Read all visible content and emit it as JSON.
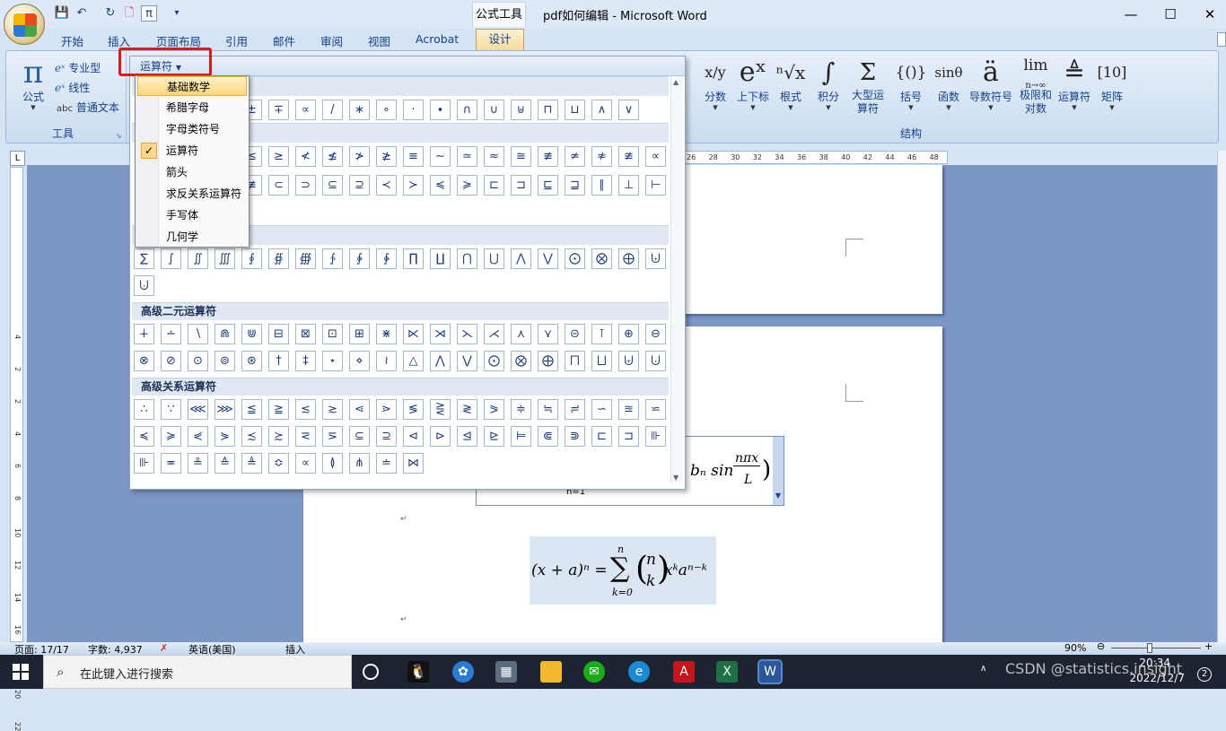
{
  "window": {
    "context_tab": "公式工具",
    "title": "pdf如何编辑 - Microsoft Word",
    "controls": {
      "minimize": "—",
      "maximize": "☐",
      "close": "✕"
    }
  },
  "qat": {
    "save": "💾",
    "undo": "↶",
    "redo": "↻",
    "pdf": "🗋",
    "pi": "π",
    "more": "▾"
  },
  "tabs": [
    "开始",
    "插入",
    "页面布局",
    "引用",
    "邮件",
    "审阅",
    "视图",
    "Acrobat",
    "设计"
  ],
  "ribbon": {
    "tools": {
      "equation_label": "公式",
      "equation_icon": "π",
      "professional": "专业型",
      "linear": "线性",
      "normal_text": "普通文本",
      "normal_text_icon": "abc",
      "group_label": "工具"
    },
    "structures": {
      "group_label": "结构",
      "buttons": [
        {
          "label": "分数",
          "icon": "x/y"
        },
        {
          "label": "上下标",
          "icon": "eˣ"
        },
        {
          "label": "根式",
          "icon": "ⁿ√x"
        },
        {
          "label": "积分",
          "icon": "∫"
        },
        {
          "label": "大型运算符",
          "icon": "Σ"
        },
        {
          "label": "括号",
          "icon": "{()}"
        },
        {
          "label": "函数",
          "icon": "sinθ"
        },
        {
          "label": "导数符号",
          "icon": "ä"
        },
        {
          "label": "极限和对数",
          "icon": "lim"
        },
        {
          "label": "运算符",
          "icon": "≜"
        },
        {
          "label": "矩阵",
          "icon": "[10]"
        }
      ],
      "limit_sub": "n→∞"
    }
  },
  "gallery": {
    "category_button": "运算符",
    "menu": [
      "基础数学",
      "希腊字母",
      "字母类符号",
      "运算符",
      "箭头",
      "求反关系运算符",
      "手写体",
      "几何学"
    ],
    "menu_checked": "运算符",
    "menu_highlighted": "基础数学",
    "row1": [
      "±",
      "∓",
      "∝",
      "/",
      "∗",
      "∘",
      "·",
      "∙",
      "∩",
      "∪",
      "⊎",
      "⊓",
      "⊔",
      "∧",
      "∨"
    ],
    "rel_row1": [
      "≤",
      "≥",
      "≮",
      "≰",
      "≯",
      "≱",
      "≡",
      "∼",
      "≃",
      "≈",
      "≅",
      "≢",
      "≄",
      "≉",
      "≇",
      "∝"
    ],
    "rel_row2": [
      "≢",
      "⊂",
      "⊃",
      "⊆",
      "⊇",
      "≺",
      "≻",
      "≼",
      "≽",
      "⊏",
      "⊐",
      "⊑",
      "⊒",
      "∥",
      "⊥",
      "⊢"
    ],
    "nary_row1": [
      "∑",
      "∫",
      "∬",
      "∭",
      "∮",
      "∯",
      "∰",
      "∱",
      "∲",
      "∳",
      "∏",
      "∐",
      "⋂",
      "⋃",
      "⋀",
      "⋁",
      "⨀",
      "⨂",
      "⨁",
      "⨄"
    ],
    "nary_row2": [
      "⨃"
    ],
    "sec_advanced_binary": "高级二元运算符",
    "adv_bin_row1": [
      "∔",
      "∸",
      "∖",
      "⋒",
      "⋓",
      "⊟",
      "⊠",
      "⊡",
      "⊞",
      "⋇",
      "⋉",
      "⋊",
      "⋋",
      "⋌",
      "⋏",
      "⋎",
      "⊝",
      "⊺",
      "⊕",
      "⊖"
    ],
    "adv_bin_row2": [
      "⊗",
      "⊘",
      "⊙",
      "⊚",
      "⊛",
      "†",
      "‡",
      "⋆",
      "⋄",
      "≀",
      "△",
      "⋀",
      "⋁",
      "⨀",
      "⨂",
      "⨁",
      "⨅",
      "⨆",
      "⨄",
      "⨃"
    ],
    "sec_advanced_relational": "高级关系运算符",
    "adv_rel_row1": [
      "∴",
      "∵",
      "⋘",
      "⋙",
      "≦",
      "≧",
      "≲",
      "≳",
      "⋖",
      "⋗",
      "≶",
      "⋛",
      "≷",
      "⪖",
      "≑",
      "≒",
      "≓",
      "∽",
      "≊",
      "⋍"
    ],
    "adv_rel_row2": [
      "≼",
      "≽",
      "⋞",
      "⋟",
      "≾",
      "≿",
      "⋜",
      "⋝",
      "⊆",
      "⊇",
      "⊲",
      "⊳",
      "⊴",
      "⊵",
      "⊨",
      "⋐",
      "⋑",
      "⊏",
      "⊐",
      "⊪"
    ],
    "adv_rel_row3": [
      "⊪",
      "≖",
      "≗",
      "≙",
      "≜",
      "≎",
      "∝",
      "≬",
      "⋔",
      "≐",
      "⋈"
    ]
  },
  "document": {
    "eq1_main": "bₙ sin",
    "eq1_num": "nπx",
    "eq1_den": "L",
    "eq1_sub": "n=1",
    "eq2_lhs": "(x + a)ⁿ =",
    "eq2_top": "n",
    "eq2_sum": "∑",
    "eq2_bottom": "k=0",
    "eq2_binom_top": "n",
    "eq2_binom_bottom": "k",
    "eq2_rhs": "xᵏaⁿ⁻ᵏ",
    "para_mark": "↵",
    "ruler_ticks": [
      "26",
      "28",
      "30",
      "32",
      "34",
      "36",
      "38",
      "40",
      "42",
      "44",
      "46",
      "48"
    ],
    "vruler_ticks": [
      "4",
      "2",
      "2",
      "4",
      "6",
      "8",
      "10",
      "12",
      "14",
      "16",
      "18",
      "20",
      "22"
    ]
  },
  "statusbar": {
    "page": "页面: 17/17",
    "words": "字数: 4,937",
    "language": "英语(美国)",
    "mode": "插入",
    "zoom": "90%",
    "zoom_minus": "⊖",
    "zoom_plus": "+"
  },
  "taskbar": {
    "search_placeholder": "在此键入进行搜索",
    "time": "20:34",
    "date": "2022/12/7",
    "watermark": "CSDN @statistics.insight",
    "notifications": "2"
  }
}
